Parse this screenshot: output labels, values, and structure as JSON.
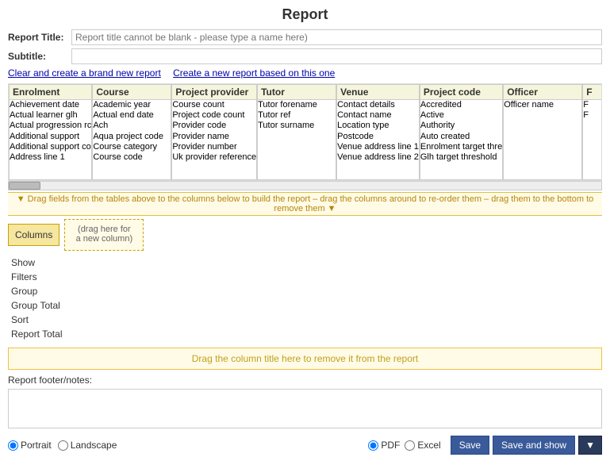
{
  "page": {
    "title": "Report",
    "report_title_label": "Report Title:",
    "report_title_placeholder": "Report title cannot be blank - please type a name here)",
    "subtitle_label": "Subtitle:",
    "subtitle_value": "",
    "link_clear": "Clear and create a brand new report",
    "link_based_on": "Create a new report based on this one",
    "drag_hint": "▼ Drag fields from the tables above to the columns below to build the report – drag the columns around to re-order them – drag them to the bottom to remove them ▼",
    "columns_label": "Columns",
    "columns_drop_hint": "(drag here for\na new column)",
    "remove_drop_hint": "Drag the column title here to remove it from the report",
    "footer_label": "Report footer/notes:",
    "sections": [
      "Show",
      "Filters",
      "Group",
      "Group Total",
      "Sort",
      "Report Total"
    ],
    "orientation": {
      "label_portrait": "Portrait",
      "label_landscape": "Landscape"
    },
    "format": {
      "label_pdf": "PDF",
      "label_excel": "Excel"
    },
    "buttons": {
      "save": "Save",
      "save_and_show": "Save and show",
      "extra": ""
    },
    "db_tables": [
      {
        "header": "Enrolment",
        "fields": [
          "Achievement date",
          "Actual learner glh",
          "Actual progression rc",
          "Additional support",
          "Additional support co",
          "Address line 1"
        ]
      },
      {
        "header": "Course",
        "fields": [
          "Academic year",
          "Actual end date",
          "Ach",
          "Aqua project code",
          "Course category",
          "Course code"
        ]
      },
      {
        "header": "Project provider",
        "fields": [
          "Course count",
          "Project code count",
          "Provider code",
          "Provider name",
          "Provider number",
          "Uk provider reference"
        ]
      },
      {
        "header": "Tutor",
        "fields": [
          "Tutor forename",
          "Tutor ref",
          "Tutor surname"
        ]
      },
      {
        "header": "Venue",
        "fields": [
          "Contact details",
          "Contact name",
          "Location type",
          "Postcode",
          "Venue address line 1",
          "Venue address line 2"
        ]
      },
      {
        "header": "Project code",
        "fields": [
          "Accredited",
          "Active",
          "Authority",
          "Auto created",
          "Enrolment target thre",
          "Glh target threshold"
        ]
      },
      {
        "header": "Officer",
        "fields": [
          "Officer name"
        ]
      },
      {
        "header": "F",
        "fields": [
          "F",
          "F"
        ]
      }
    ]
  }
}
